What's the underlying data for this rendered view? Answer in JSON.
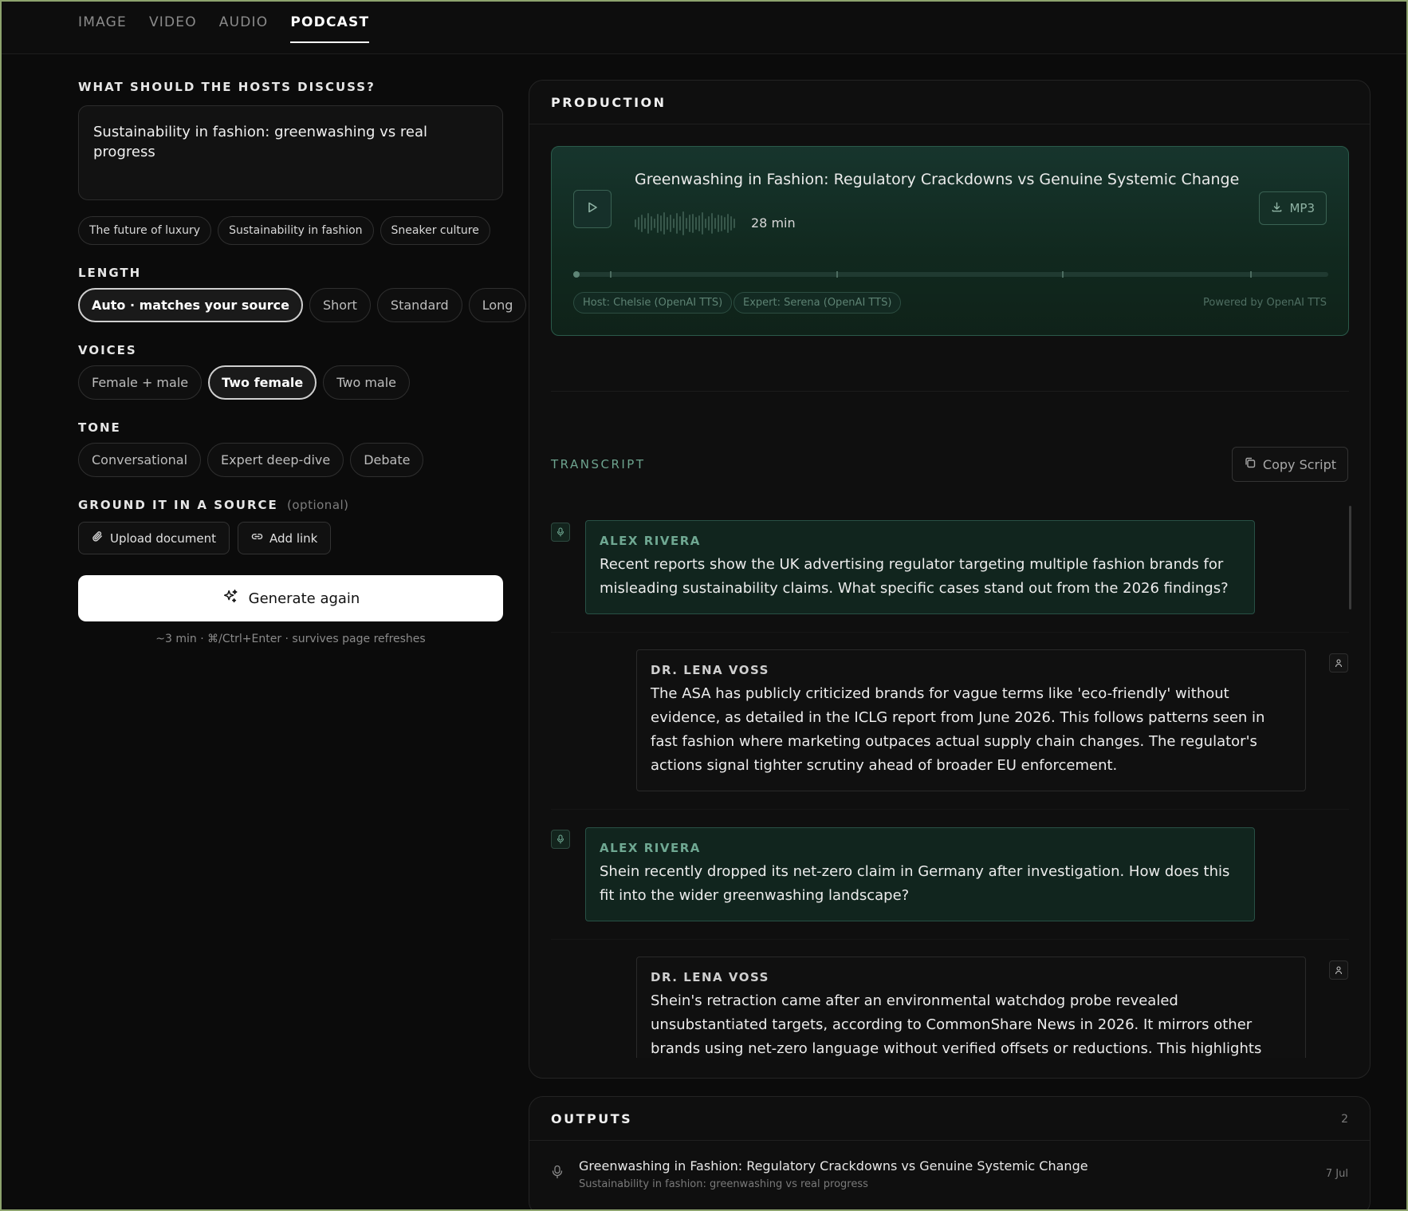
{
  "tabs": [
    {
      "label": "IMAGE"
    },
    {
      "label": "VIDEO"
    },
    {
      "label": "AUDIO"
    },
    {
      "label": "PODCAST"
    }
  ],
  "left": {
    "prompt_label": "WHAT SHOULD THE HOSTS DISCUSS?",
    "prompt_value": "Sustainability in fashion: greenwashing vs real progress",
    "suggestions": [
      "The future of luxury",
      "Sustainability in fashion",
      "Sneaker culture"
    ],
    "length_label": "LENGTH",
    "length_options": [
      "Auto · matches your source",
      "Short",
      "Standard",
      "Long"
    ],
    "length_selected": "Auto · matches your source",
    "voices_label": "VOICES",
    "voices_options": [
      "Female + male",
      "Two female",
      "Two male"
    ],
    "voices_selected": "Two female",
    "tone_label": "TONE",
    "tone_options": [
      "Conversational",
      "Expert deep-dive",
      "Debate"
    ],
    "source_label": "GROUND IT IN A SOURCE",
    "source_optional": "(optional)",
    "upload_label": "Upload document",
    "link_label": "Add link",
    "generate_label": "Generate again",
    "generate_hint": "~3 min · ⌘/Ctrl+Enter · survives page refreshes"
  },
  "production": {
    "header": "PRODUCTION",
    "episode_title": "Greenwashing in Fashion: Regulatory Crackdowns vs Genuine Systemic Change",
    "duration": "28 min",
    "download_label": "MP3",
    "progress": 0,
    "host_voice": "Host: Chelsie (OpenAI TTS)",
    "expert_voice": "Expert: Serena (OpenAI TTS)",
    "powered_by": "Powered by OpenAI TTS",
    "accent_color": "#6da38e"
  },
  "transcript": {
    "label": "TRANSCRIPT",
    "copy_label": "Copy Script",
    "turns": [
      {
        "role": "host",
        "speaker": "ALEX RIVERA",
        "text": "Recent reports show the UK advertising regulator targeting multiple fashion brands for misleading sustainability claims. What specific cases stand out from the 2026 findings?"
      },
      {
        "role": "expert",
        "speaker": "DR. LENA VOSS",
        "text": "The ASA has publicly criticized brands for vague terms like 'eco-friendly' without evidence, as detailed in the ICLG report from June 2026. This follows patterns seen in fast fashion where marketing outpaces actual supply chain changes. The regulator's actions signal tighter scrutiny ahead of broader EU enforcement."
      },
      {
        "role": "host",
        "speaker": "ALEX RIVERA",
        "text": "Shein recently dropped its net-zero claim in Germany after investigation. How does this fit into the wider greenwashing landscape?"
      },
      {
        "role": "expert",
        "speaker": "DR. LENA VOSS",
        "text": "Shein's retraction came after an environmental watchdog probe revealed unsubstantiated targets, according to CommonShare News in 2026. It mirrors other brands using net-zero language without verified offsets or reductions. This highlights how social media scrutiny is"
      }
    ]
  },
  "outputs": {
    "header": "OUTPUTS",
    "count": "2",
    "items": [
      {
        "title": "Greenwashing in Fashion: Regulatory Crackdowns vs Genuine Systemic Change",
        "subtitle": "Sustainability in fashion: greenwashing vs real progress",
        "date": "7 Jul"
      }
    ]
  }
}
